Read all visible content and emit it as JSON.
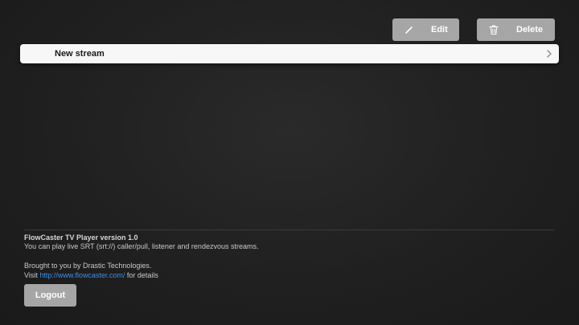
{
  "toolbar": {
    "edit_label": "Edit",
    "delete_label": "Delete",
    "edit_icon": "pencil-icon",
    "delete_icon": "trash-icon"
  },
  "streams": {
    "items": [
      {
        "label": "New stream",
        "icon": "chevron-right-icon"
      }
    ]
  },
  "footer": {
    "title": "FlowCaster TV Player version 1.0",
    "description": "You can play live SRT (srt://) caller/pull, listener and rendezvous streams.",
    "credit": "Brought to you by Drastic Technologies.",
    "visit_prefix": "Visit ",
    "link_text": "http://www.flowcaster.com/",
    "visit_suffix": " for details",
    "logout_label": "Logout"
  },
  "colors": {
    "background": "#1f1f1f",
    "button": "#a6a6a6",
    "row": "#f7f7f7",
    "link": "#3e8ee6"
  }
}
